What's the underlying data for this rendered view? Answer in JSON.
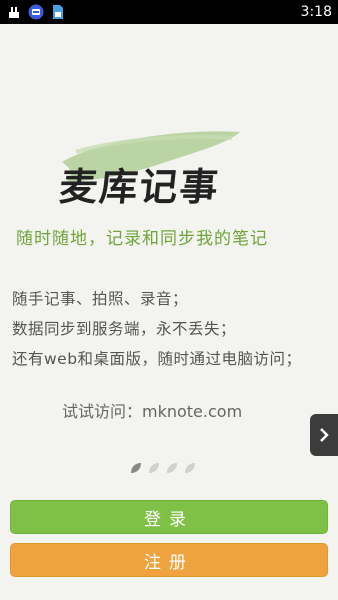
{
  "status_bar": {
    "time": "3:18",
    "icons": [
      "usb-debug-icon",
      "app-notification-icon",
      "sim-card-icon"
    ]
  },
  "app": {
    "title": "麦库记事",
    "tagline": "随时随地，记录和同步我的笔记",
    "features": [
      "随手记事、拍照、录音；",
      "数据同步到服务端，永不丢失；",
      "还有web和桌面版，随时通过电脑访问；"
    ],
    "visit_text": "试试访问：mknote.com"
  },
  "carousel": {
    "page_count": 4,
    "current_page": 1
  },
  "buttons": {
    "login_label": "登录",
    "register_label": "注册"
  },
  "colors": {
    "accent_green": "#7fc046",
    "accent_orange": "#eea33e",
    "tagline_green": "#6ea53a",
    "brush_green": "#a7c98a"
  }
}
